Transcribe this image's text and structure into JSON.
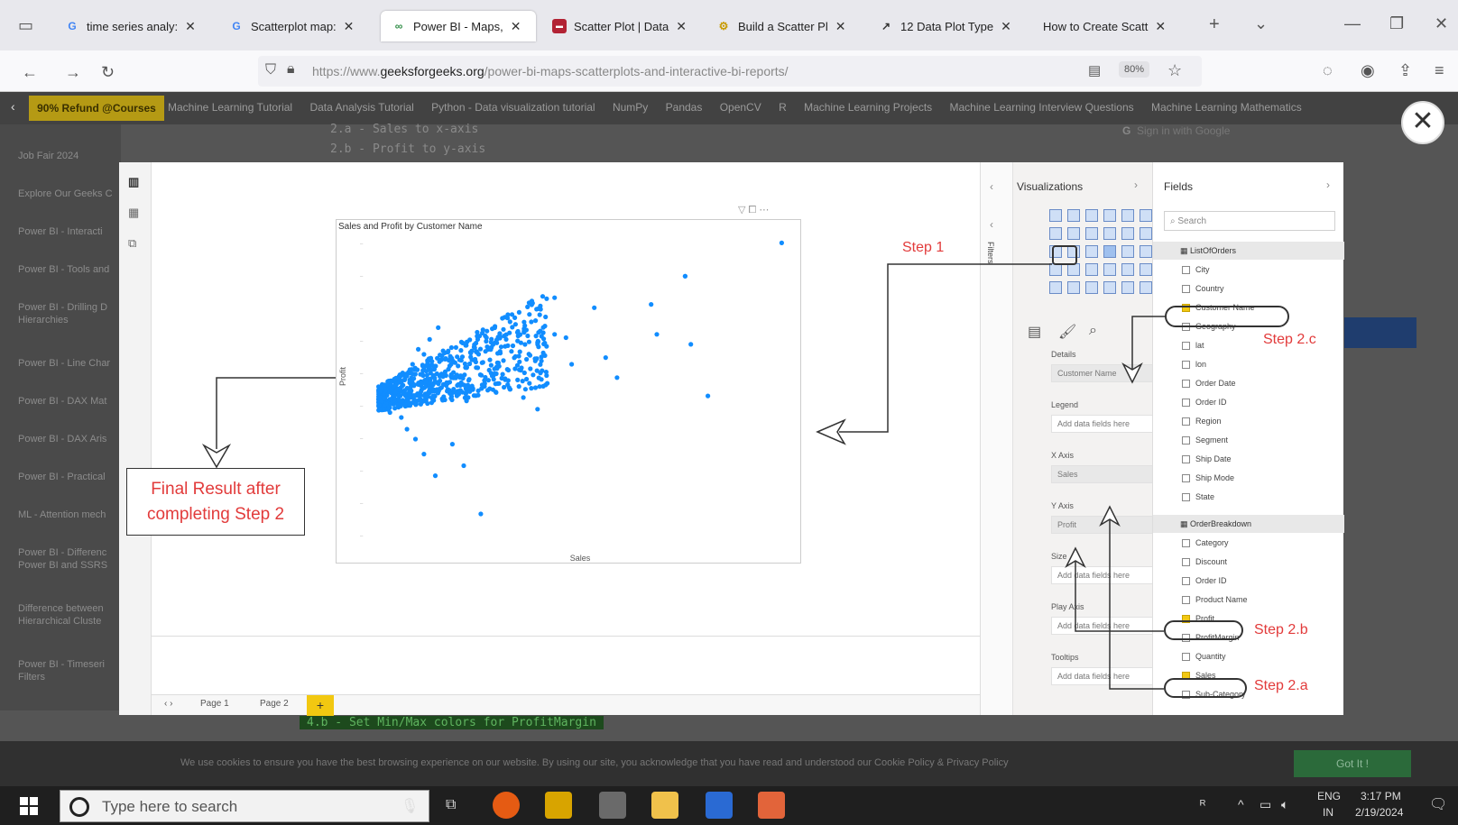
{
  "browser": {
    "tabs": [
      {
        "label": "time series analy:",
        "icon": "google-icon",
        "active": false
      },
      {
        "label": "Scatterplot map:",
        "icon": "google-icon",
        "active": false
      },
      {
        "label": "Power BI - Maps,",
        "icon": "gfg-icon",
        "active": true
      },
      {
        "label": "Scatter Plot | Data",
        "icon": "flag-icon",
        "active": false
      },
      {
        "label": "Build a Scatter Pl",
        "icon": "gear-icon",
        "active": false
      },
      {
        "label": "12 Data Plot Type",
        "icon": "plot-icon",
        "active": false
      },
      {
        "label": "How to Create Scatt",
        "icon": "blank-icon",
        "active": false
      }
    ],
    "url_prefix": "https://www.",
    "url_domain": "geeksforgeeks.org",
    "url_path": "/power-bi-maps-scatterplots-and-interactive-bi-reports/",
    "zoom": "80%"
  },
  "site": {
    "promo": "90% Refund @Courses",
    "nav": [
      "Machine Learning Tutorial",
      "Data Analysis Tutorial",
      "Python - Data visualization tutorial",
      "NumPy",
      "Pandas",
      "OpenCV",
      "R",
      "Machine Learning Projects",
      "Machine Learning Interview Questions",
      "Machine Learning Mathematics"
    ],
    "code_lines": [
      "2.a - Sales to x-axis",
      "2.b - Profit to y-axis"
    ],
    "google_signin": "Sign in with Google",
    "sidebar": [
      "Job Fair 2024",
      "Explore Our Geeks C",
      "Power BI - Interacti",
      "Power BI - Tools and",
      "Power BI - Drilling D Hierarchies",
      "Power BI - Line Char",
      "Power BI - DAX Mat",
      "Power BI - DAX Aris",
      "Power BI - Practical",
      "ML - Attention mech",
      "Power BI - Differenc Power BI and SSRS",
      "Difference between Hierarchical Cluste",
      "Power BI - Timeseri Filters"
    ],
    "bottom_code": "4.b - Set Min/Max colors for ProfitMargin",
    "cookie_text": "We use cookies to ensure you have the best browsing experience on our website. By using our site, you acknowledge that you have read and understood our Cookie Policy & Privacy Policy",
    "got_it": "Got It !"
  },
  "powerbi": {
    "visual_title": "Sales and Profit by Customer Name",
    "x_axis_label": "Sales",
    "y_axis_label": "Profit",
    "pages": [
      "Page 1",
      "Page 2"
    ],
    "add_page": "+",
    "visualizations_title": "Visualizations",
    "fields_title": "Fields",
    "filters_label": "Filters",
    "search_placeholder": "Search",
    "wells": [
      {
        "label": "Details",
        "value": "Customer Name",
        "filled": true
      },
      {
        "label": "Legend",
        "value": "Add data fields here",
        "filled": false
      },
      {
        "label": "X Axis",
        "value": "Sales",
        "filled": true
      },
      {
        "label": "Y Axis",
        "value": "Profit",
        "filled": true
      },
      {
        "label": "Size",
        "value": "Add data fields here",
        "filled": false
      },
      {
        "label": "Play Axis",
        "value": "Add data fields here",
        "filled": false
      },
      {
        "label": "Tooltips",
        "value": "Add data fields here",
        "filled": false
      }
    ],
    "tables": [
      {
        "name": "ListOfOrders",
        "fields": [
          {
            "name": "City",
            "checked": false
          },
          {
            "name": "Country",
            "checked": false
          },
          {
            "name": "Customer Name",
            "checked": true
          },
          {
            "name": "Geography",
            "checked": false
          },
          {
            "name": "lat",
            "checked": false
          },
          {
            "name": "lon",
            "checked": false
          },
          {
            "name": "Order Date",
            "checked": false
          },
          {
            "name": "Order ID",
            "checked": false
          },
          {
            "name": "Region",
            "checked": false
          },
          {
            "name": "Segment",
            "checked": false
          },
          {
            "name": "Ship Date",
            "checked": false
          },
          {
            "name": "Ship Mode",
            "checked": false
          },
          {
            "name": "State",
            "checked": false
          }
        ]
      },
      {
        "name": "OrderBreakdown",
        "fields": [
          {
            "name": "Category",
            "checked": false
          },
          {
            "name": "Discount",
            "checked": false
          },
          {
            "name": "Order ID",
            "checked": false
          },
          {
            "name": "Product Name",
            "checked": false
          },
          {
            "name": "Profit",
            "checked": true
          },
          {
            "name": "ProfitMargin",
            "checked": false
          },
          {
            "name": "Quantity",
            "checked": false
          },
          {
            "name": "Sales",
            "checked": true
          },
          {
            "name": "Sub-Category",
            "checked": false
          }
        ]
      }
    ]
  },
  "annotations": {
    "step1": "Step 1",
    "step2c": "Step 2.c",
    "step2b": "Step 2.b",
    "step2a": "Step 2.a",
    "final_line1": "Final Result after",
    "final_line2": "completing Step 2"
  },
  "taskbar": {
    "search_placeholder": "Type here to search",
    "lang1": "ENG",
    "lang2": "IN",
    "time": "3:17 PM",
    "date": "2/19/2024"
  },
  "chart_data": {
    "type": "scatter",
    "title": "Sales and Profit by Customer Name",
    "xlabel": "Sales",
    "ylabel": "Profit",
    "series": [
      {
        "points_description_count": 793
      }
    ],
    "sample_points": [
      [
        6,
        -0.2
      ],
      [
        8,
        0.2
      ],
      [
        10,
        0.6
      ],
      [
        12,
        1.2
      ],
      [
        14,
        1.6
      ],
      [
        16,
        2.3
      ],
      [
        18,
        3.2
      ],
      [
        20,
        2.9
      ],
      [
        22,
        3.8
      ],
      [
        25,
        4.5
      ],
      [
        8,
        -0.6
      ],
      [
        12,
        -0.9
      ],
      [
        14,
        -1.6
      ],
      [
        17,
        -2.2
      ],
      [
        20,
        -3.1
      ],
      [
        24,
        -4.4
      ],
      [
        30,
        -2.5
      ],
      [
        34,
        -3.8
      ],
      [
        40,
        -6.7
      ],
      [
        60,
        3.6
      ],
      [
        62,
        4.2
      ],
      [
        66,
        4.1
      ],
      [
        70,
        3.9
      ],
      [
        72,
        2.3
      ],
      [
        80,
        5.7
      ],
      [
        84,
        2.7
      ],
      [
        88,
        1.5
      ],
      [
        100,
        5.9
      ],
      [
        102,
        4.1
      ],
      [
        112,
        7.6
      ],
      [
        114,
        3.5
      ],
      [
        120,
        0.4
      ],
      [
        146,
        9.6
      ],
      [
        112,
        7.6
      ],
      [
        42,
        3.9
      ],
      [
        48,
        4.4
      ],
      [
        52,
        5.1
      ],
      [
        57,
        6.0
      ],
      [
        58,
        6.1
      ],
      [
        66,
        6.3
      ],
      [
        38,
        2.6
      ],
      [
        44,
        1.6
      ],
      [
        50,
        0.9
      ],
      [
        55,
        0.3
      ],
      [
        60,
        -0.4
      ],
      [
        35,
        0.1
      ],
      [
        28,
        1.2
      ],
      [
        32,
        2.2
      ]
    ]
  }
}
